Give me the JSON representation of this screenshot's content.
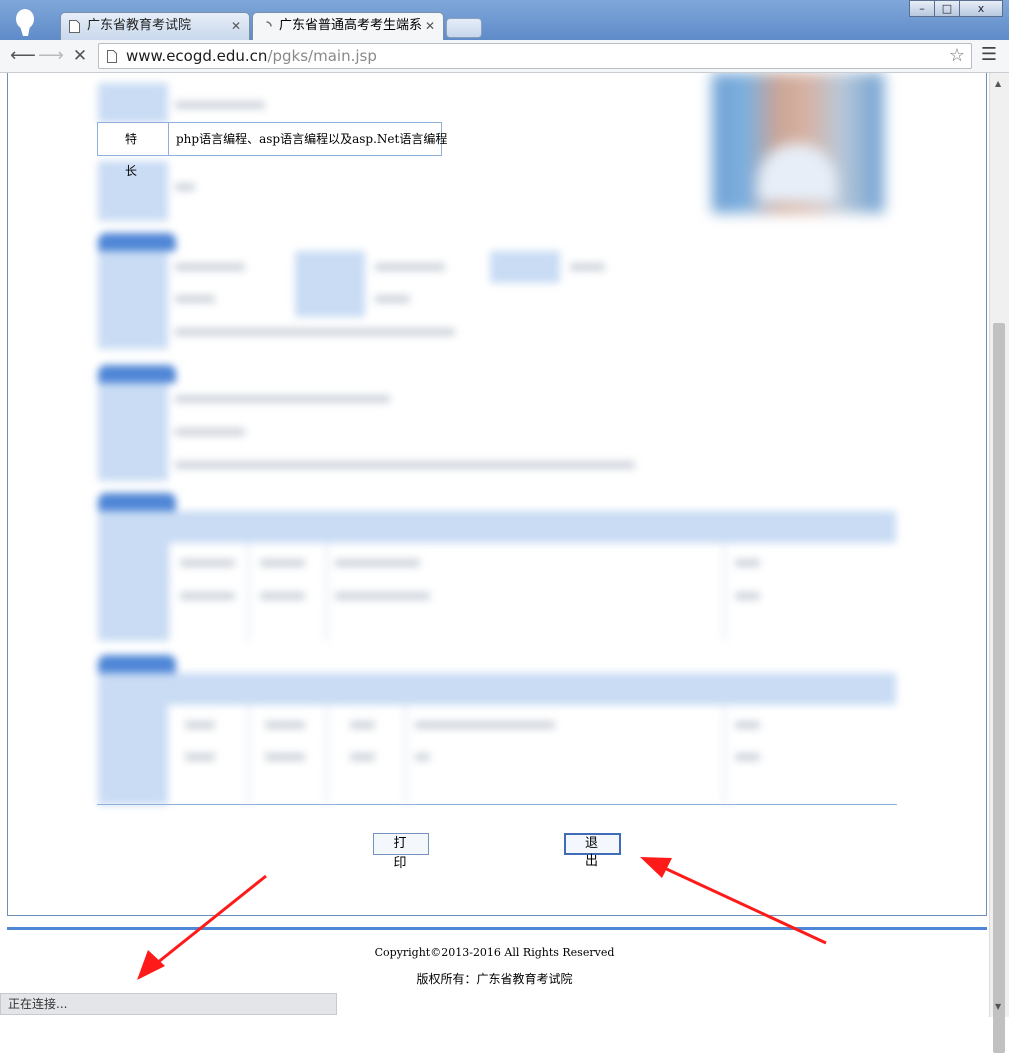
{
  "browser": {
    "tabs": [
      {
        "title": "广东省教育考试院",
        "active": false
      },
      {
        "title": "广东省普通高考考生端系",
        "active": true
      }
    ],
    "window_controls": {
      "minimize": "–",
      "maximize": "□",
      "close": "x"
    },
    "url_domain": "www.ecogd.edu.cn",
    "url_path": "/pgks/main.jsp",
    "status_text": "正在连接..."
  },
  "page": {
    "specialty_label": "特 长",
    "specialty_value": "php语言编程、asp语言编程以及asp.Net语言编程",
    "print_button": "打 印",
    "exit_button": "退 出",
    "copyright": "Copyright©2013-2016 All Rights Reserved",
    "rights_owner": "版权所有：广东省教育考试院"
  },
  "annotations": {
    "arrow_color": "#ff1a1a",
    "arrow_targets": [
      "exit-button",
      "status-text"
    ]
  },
  "colors": {
    "accent_blue": "#4f86d6",
    "label_bg": "#c9dcf4"
  }
}
